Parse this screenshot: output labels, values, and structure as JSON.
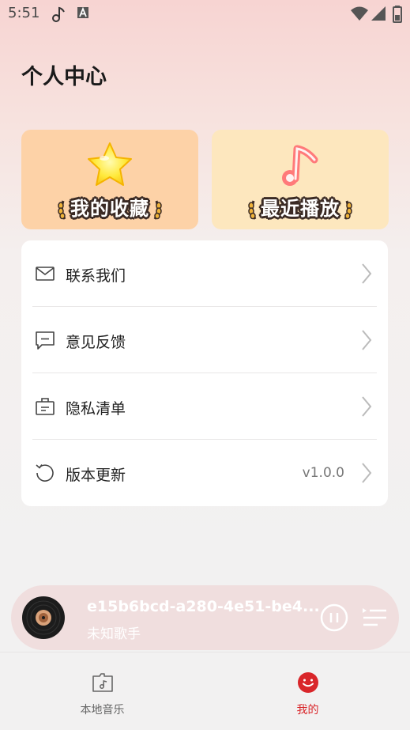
{
  "status_bar": {
    "time": "5:51",
    "icons": [
      "music-note-icon",
      "font-a-icon",
      "wifi-icon",
      "signal-icon",
      "battery-icon"
    ]
  },
  "page": {
    "title": "个人中心"
  },
  "cards": [
    {
      "label": "我的收藏",
      "icon": "star-icon",
      "bg_color": "#fdd2a7"
    },
    {
      "label": "最近播放",
      "icon": "music-note-icon",
      "bg_color": "#fde7be"
    }
  ],
  "menu": {
    "items": [
      {
        "label": "联系我们",
        "icon": "mail-icon",
        "value": ""
      },
      {
        "label": "意见反馈",
        "icon": "feedback-icon",
        "value": ""
      },
      {
        "label": "隐私清单",
        "icon": "briefcase-icon",
        "value": ""
      },
      {
        "label": "版本更新",
        "icon": "refresh-icon",
        "value": "v1.0.0"
      }
    ]
  },
  "player": {
    "title": "e15b6bcd-a280-4e51-be4...",
    "artist": "未知歌手",
    "state": "playing"
  },
  "bottom_nav": {
    "items": [
      {
        "label": "本地音乐",
        "icon": "music-folder-icon",
        "active": false
      },
      {
        "label": "我的",
        "icon": "smile-icon",
        "active": true
      }
    ]
  },
  "colors": {
    "accent": "#d9262a",
    "page_bg": "#f2f1f1"
  }
}
